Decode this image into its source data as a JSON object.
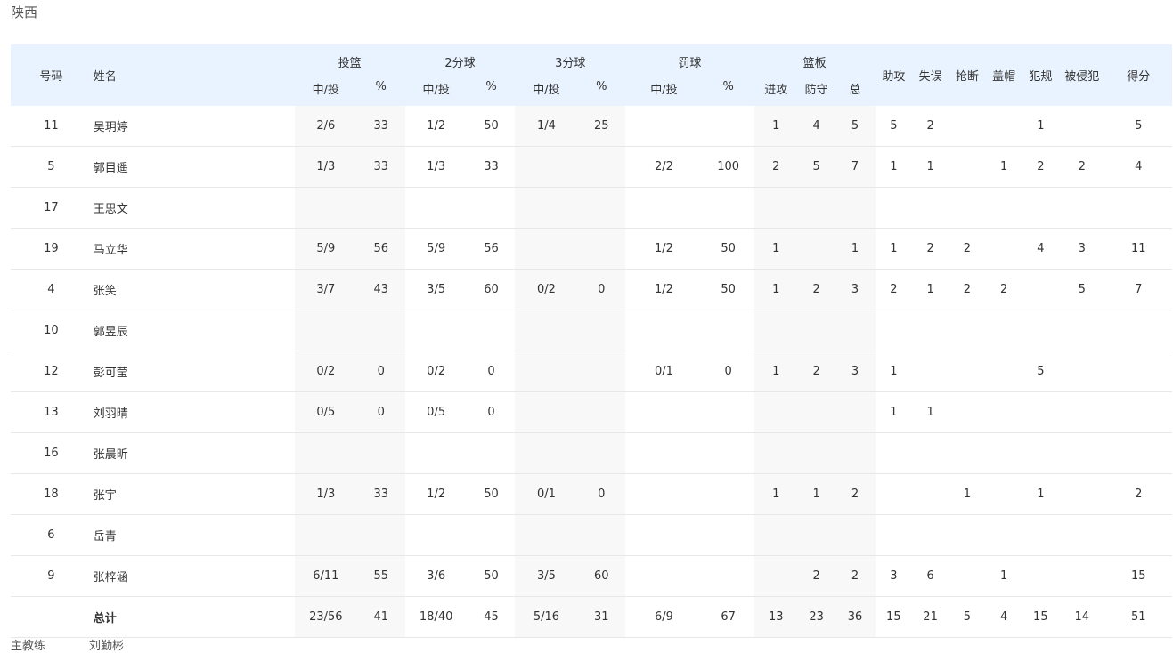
{
  "team": {
    "name": "陕西"
  },
  "table": {
    "headers": {
      "number": "号码",
      "name": "姓名",
      "fg": "投篮",
      "two": "2分球",
      "three": "3分球",
      "ft": "罚球",
      "reb": "篮板",
      "made_att": "中/投",
      "pct": "%",
      "off": "进攻",
      "def": "防守",
      "tot": "总",
      "ast": "助攻",
      "to": "失误",
      "stl": "抢断",
      "blk": "盖帽",
      "pf": "犯规",
      "fd": "被侵犯",
      "pts": "得分"
    },
    "rows": [
      [
        "11",
        "吴玥婷",
        "2/6",
        "33",
        "1/2",
        "50",
        "1/4",
        "25",
        "",
        "",
        "1",
        "4",
        "5",
        "5",
        "2",
        "",
        "",
        "1",
        "",
        "5"
      ],
      [
        "5",
        "郭目遥",
        "1/3",
        "33",
        "1/3",
        "33",
        "",
        "",
        "2/2",
        "100",
        "2",
        "5",
        "7",
        "1",
        "1",
        "",
        "1",
        "2",
        "2",
        "4"
      ],
      [
        "17",
        "王思文",
        "",
        "",
        "",
        "",
        "",
        "",
        "",
        "",
        "",
        "",
        "",
        "",
        "",
        "",
        "",
        "",
        "",
        ""
      ],
      [
        "19",
        "马立华",
        "5/9",
        "56",
        "5/9",
        "56",
        "",
        "",
        "1/2",
        "50",
        "1",
        "",
        "1",
        "1",
        "2",
        "2",
        "",
        "4",
        "3",
        "11"
      ],
      [
        "4",
        "张笑",
        "3/7",
        "43",
        "3/5",
        "60",
        "0/2",
        "0",
        "1/2",
        "50",
        "1",
        "2",
        "3",
        "2",
        "1",
        "2",
        "2",
        "",
        "5",
        "7"
      ],
      [
        "10",
        "郭昱辰",
        "",
        "",
        "",
        "",
        "",
        "",
        "",
        "",
        "",
        "",
        "",
        "",
        "",
        "",
        "",
        "",
        "",
        ""
      ],
      [
        "12",
        "彭可莹",
        "0/2",
        "0",
        "0/2",
        "0",
        "",
        "",
        "0/1",
        "0",
        "1",
        "2",
        "3",
        "1",
        "",
        "",
        "",
        "5",
        "",
        ""
      ],
      [
        "13",
        "刘羽晴",
        "0/5",
        "0",
        "0/5",
        "0",
        "",
        "",
        "",
        "",
        "",
        "",
        "",
        "1",
        "1",
        "",
        "",
        "",
        "",
        ""
      ],
      [
        "16",
        "张晨昕",
        "",
        "",
        "",
        "",
        "",
        "",
        "",
        "",
        "",
        "",
        "",
        "",
        "",
        "",
        "",
        "",
        "",
        ""
      ],
      [
        "18",
        "张宇",
        "1/3",
        "33",
        "1/2",
        "50",
        "0/1",
        "0",
        "",
        "",
        "1",
        "1",
        "2",
        "",
        "",
        "1",
        "",
        "1",
        "",
        "2"
      ],
      [
        "6",
        "岳青",
        "",
        "",
        "",
        "",
        "",
        "",
        "",
        "",
        "",
        "",
        "",
        "",
        "",
        "",
        "",
        "",
        "",
        ""
      ],
      [
        "9",
        "张梓涵",
        "6/11",
        "55",
        "3/6",
        "50",
        "3/5",
        "60",
        "",
        "",
        "",
        "2",
        "2",
        "3",
        "6",
        "",
        "1",
        "",
        "",
        "15"
      ]
    ],
    "total": [
      "",
      "总计",
      "23/56",
      "41",
      "18/40",
      "45",
      "5/16",
      "31",
      "6/9",
      "67",
      "13",
      "23",
      "36",
      "15",
      "21",
      "5",
      "4",
      "15",
      "14",
      "51"
    ]
  },
  "footer": {
    "label": "主教练",
    "value": "刘勤彬"
  }
}
